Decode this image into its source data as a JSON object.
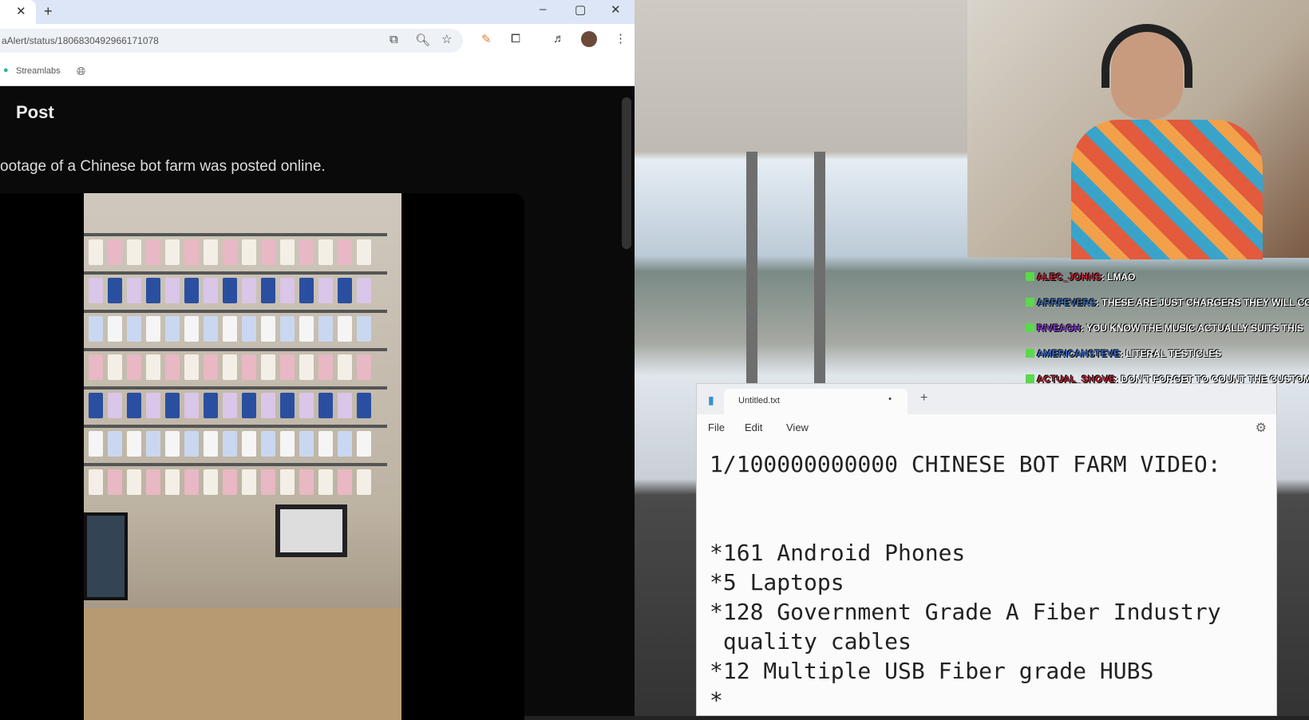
{
  "browser": {
    "url": "aAlert/status/1806830492966171078",
    "bookmark": "Streamlabs",
    "post_title": "Post",
    "tweet_text": "ootage of a Chinese bot farm was posted online."
  },
  "chat": [
    {
      "user": "ALEC_JOHNS",
      "color": "#c0283a",
      "message": "LMAO"
    },
    {
      "user": "ARRFEVERS",
      "color": "#3f6fb0",
      "message": "THESE ARE JUST CHARGERS THEY WILL CO"
    },
    {
      "user": "RIVEAGH",
      "color": "#8a3fd0",
      "message": "YOU KNOW THE MUSIC ACTUALLY SUITS THIS"
    },
    {
      "user": "AMERICANSTEVE",
      "color": "#3f6fd0",
      "message": "LITERAL TESTICLES"
    },
    {
      "user": "ACTUAL_SHOVE",
      "color": "#c0283a",
      "message": "DON'T FORGET TO COUNT THE CUSTOM W"
    }
  ],
  "notepad": {
    "tab_title": "Untitled.txt",
    "menu": [
      "File",
      "Edit",
      "View"
    ],
    "content": "1/100000000000 CHINESE BOT FARM VIDEO:\n\n\n*161 Android Phones\n*5 Laptops\n*128 Government Grade A Fiber Industry\n quality cables\n*12 Multiple USB Fiber grade HUBS\n*"
  }
}
